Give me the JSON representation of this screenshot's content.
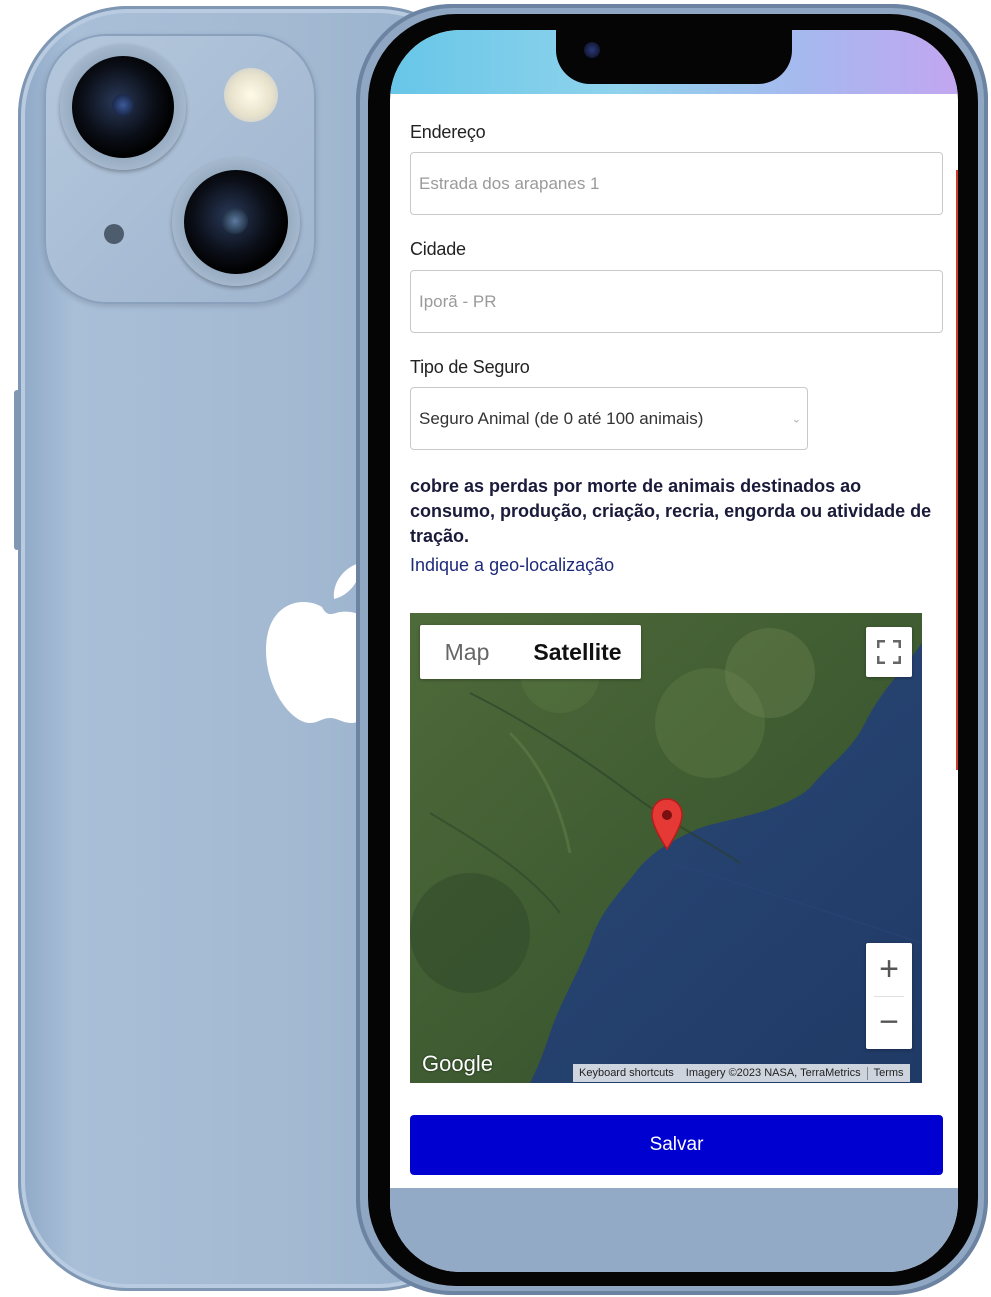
{
  "form": {
    "address_label": "Endereço",
    "address_placeholder": "Estrada dos arapanes 1",
    "city_label": "Cidade",
    "city_placeholder": "Iporã - PR",
    "insurance_type_label": "Tipo de Seguro",
    "insurance_type_selected": "Seguro Animal (de 0 até 100 animais)",
    "insurance_description": "cobre as perdas por morte de animais destinados ao consumo, produção, criação, recria, engorda ou atividade de tração.",
    "geo_label": "Indique a geo-localização",
    "save_label": "Salvar"
  },
  "map": {
    "type_map_label": "Map",
    "type_satellite_label": "Satellite",
    "selected_type": "Satellite",
    "zoom_in_symbol": "+",
    "zoom_out_symbol": "−",
    "google_logo": "Google",
    "keyboard_shortcuts": "Keyboard shortcuts",
    "imagery_credit": "Imagery ©2023 NASA, TerraMetrics",
    "terms": "Terms",
    "marker_icon": "map-pin-icon",
    "fullscreen_icon": "fullscreen-icon"
  },
  "colors": {
    "save_button": "#0000d0",
    "link_text": "#1e2a7a",
    "pin": "#e53935",
    "phone_body": "#a3b9d2"
  }
}
